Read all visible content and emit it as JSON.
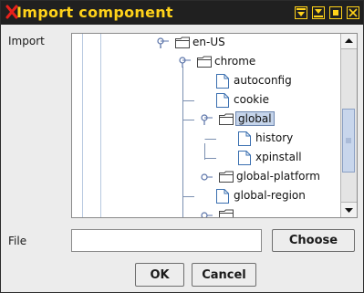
{
  "window": {
    "title": "Import component",
    "accent_color": "#ffd21a",
    "close_glyph_color": "#e8211b",
    "icons": [
      "app-x-icon",
      "minimize-icon",
      "maximize-icon",
      "close-icon"
    ]
  },
  "import_label": "Import",
  "tree": {
    "nodes": [
      {
        "label": "en-US",
        "type": "folder",
        "expanded": true
      },
      {
        "label": "chrome",
        "type": "folder",
        "expanded": true
      },
      {
        "label": "autoconfig",
        "type": "file"
      },
      {
        "label": "cookie",
        "type": "file"
      },
      {
        "label": "global",
        "type": "folder",
        "expanded": true,
        "selected": true
      },
      {
        "label": "history",
        "type": "file"
      },
      {
        "label": "xpinstall",
        "type": "file"
      },
      {
        "label": "global-platform",
        "type": "folder",
        "expanded": false
      },
      {
        "label": "global-region",
        "type": "file"
      }
    ],
    "selection_color": "#c5d4ea",
    "scroll_position": 0.55
  },
  "file": {
    "label": "File",
    "value": "",
    "choose_label": "Choose"
  },
  "buttons": {
    "ok_label": "OK",
    "cancel_label": "Cancel"
  }
}
